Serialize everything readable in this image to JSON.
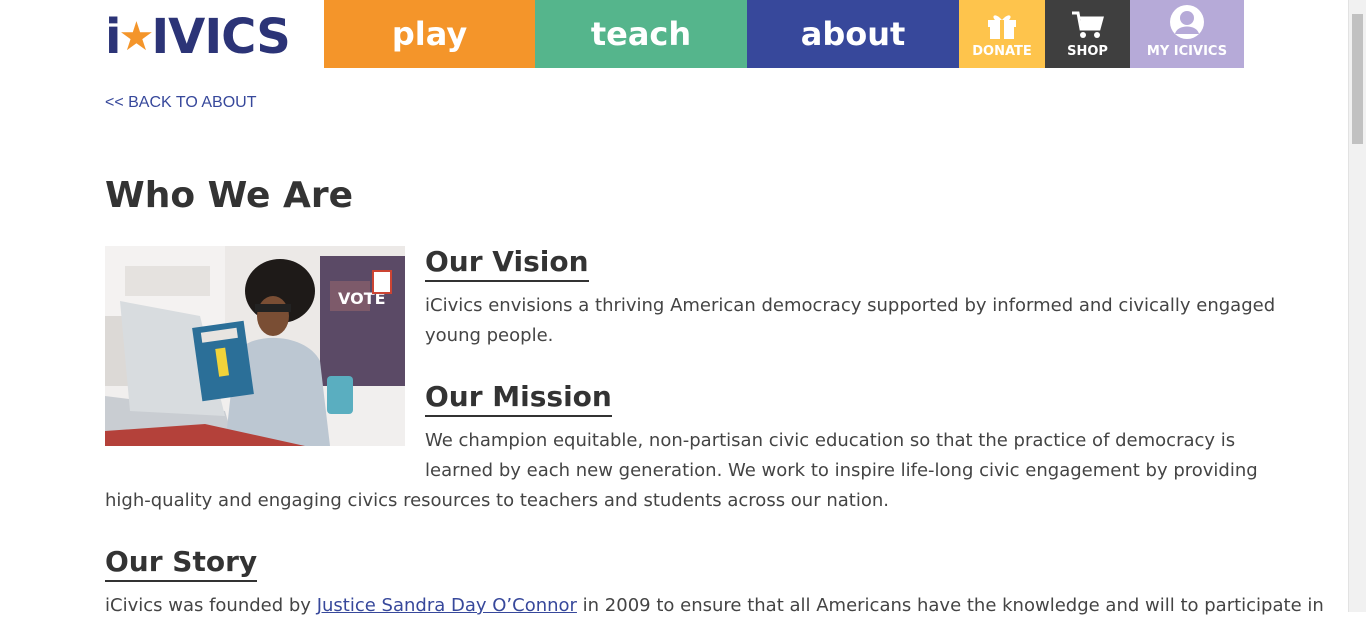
{
  "header": {
    "logo_text": "iCivics",
    "nav": {
      "play": "play",
      "teach": "teach",
      "about": "about"
    },
    "util": {
      "donate": "DONATE",
      "shop": "SHOP",
      "my": "MY ICIVICS"
    }
  },
  "back_link": "<< BACK TO ABOUT",
  "page_title": "Who We Are",
  "vision": {
    "heading": "Our Vision",
    "lines": [
      "iCivics envisions a thriving American democracy supported by informed and civically engaged",
      "young people."
    ]
  },
  "mission": {
    "heading": "Our Mission",
    "lines": [
      "We champion equitable, non-partisan civic education so that the practice of democracy is",
      "learned by each new generation. We work to inspire life-long civic engagement by providing",
      "high-quality and engaging civics resources to teachers and students across our nation."
    ]
  },
  "story": {
    "heading": "Our Story",
    "text_before": "iCivics was founded by ",
    "link_text": "Justice Sandra Day O’Connor",
    "text_after": " in 2009 to ensure that all Americans have the knowledge and will to participate in"
  },
  "photo_text": {
    "vote": "VOTE"
  },
  "colors": {
    "orange": "#f4952a",
    "green": "#55b58c",
    "blue": "#37489b",
    "yellow": "#fec44c",
    "dark": "#3f3f3f",
    "lavender": "#b6aad8",
    "navy": "#2c3477"
  }
}
